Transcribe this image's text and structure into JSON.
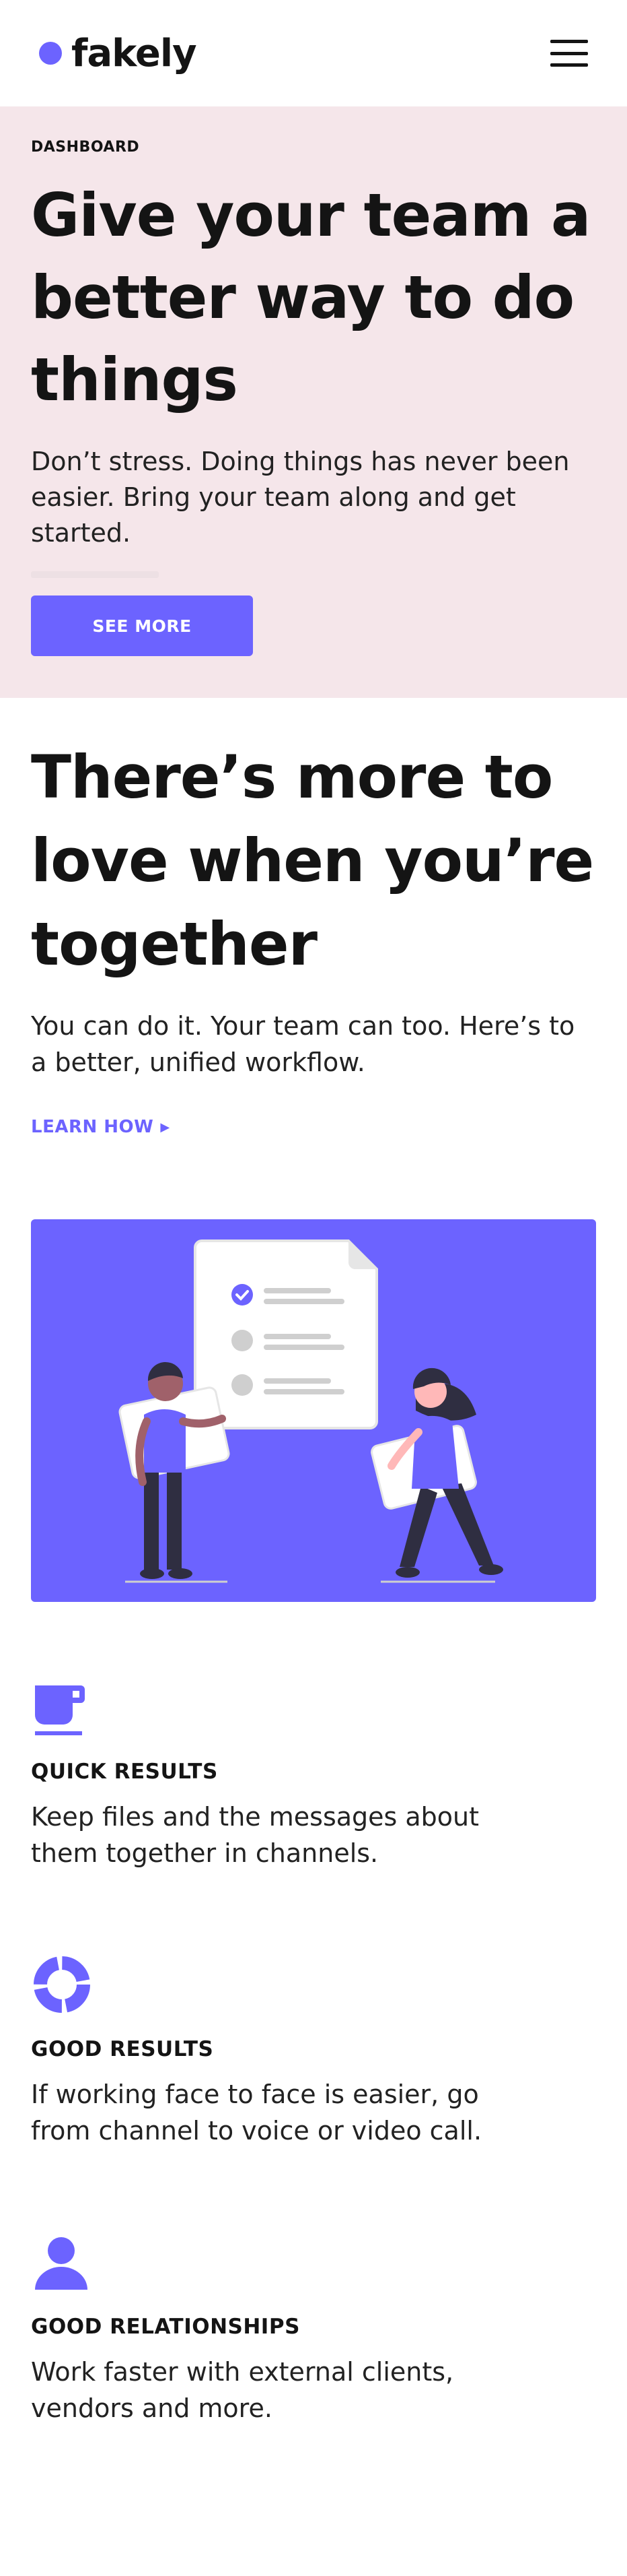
{
  "header": {
    "brand": "fakely",
    "menu_icon": "hamburger-menu-icon"
  },
  "hero": {
    "eyebrow": "DASHBOARD",
    "title": "Give your team a better way to do things",
    "text": "Don’t stress. Doing things has never been easier. Bring your team along and get started.",
    "button_label": "SEE MORE"
  },
  "section": {
    "title": "There’s more to love when you’re together",
    "text": "You can do it. Your team can too. Here’s to a better, unified workflow.",
    "link_label": "LEARN HOW",
    "link_icon": "play-arrow-icon"
  },
  "features": [
    {
      "icon": "coffee-cup-icon",
      "title": "QUICK RESULTS",
      "text": "Keep files and the messages about them together in channels."
    },
    {
      "icon": "donut-chart-icon",
      "title": "GOOD RESULTS",
      "text": "If working face to face is easier, go from channel to voice or video call."
    },
    {
      "icon": "person-icon",
      "title": "GOOD RELATIONSHIPS",
      "text": "Work faster with external clients, vendors and more."
    }
  ],
  "colors": {
    "accent": "#6c63ff",
    "hero_bg": "#f5e6ea",
    "text": "#141414"
  }
}
